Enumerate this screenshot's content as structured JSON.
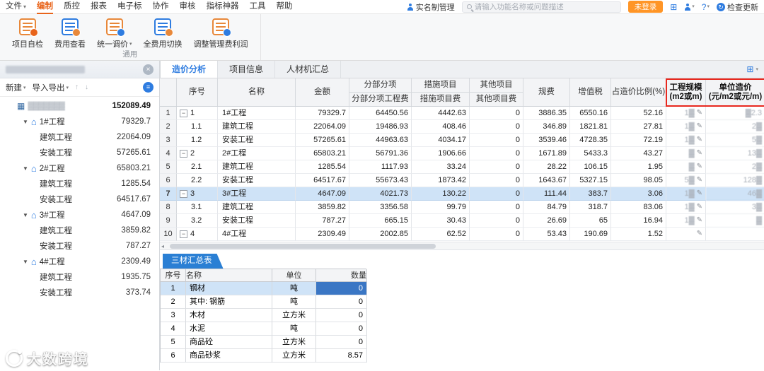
{
  "menubar": {
    "items": [
      {
        "label": "文件",
        "caret": true
      },
      {
        "label": "编制",
        "active": true
      },
      {
        "label": "质控"
      },
      {
        "label": "报表"
      },
      {
        "label": "电子标"
      },
      {
        "label": "协作"
      },
      {
        "label": "审核"
      },
      {
        "label": "指标神器"
      },
      {
        "label": "工具"
      },
      {
        "label": "帮助"
      }
    ],
    "realname_label": "实名制管理",
    "search_placeholder": "请输入功能名称或问题描述",
    "login_badge": "未登录",
    "check_update_label": "检查更新"
  },
  "ribbon": {
    "group_label": "通用",
    "buttons": [
      {
        "label": "项目自检",
        "icon": "project-check-icon"
      },
      {
        "label": "费用查看",
        "icon": "fee-view-icon"
      },
      {
        "label": "统一调价",
        "icon": "unified-price-adjust-icon",
        "caret": true
      },
      {
        "label": "全费用切换",
        "icon": "full-fee-toggle-icon"
      },
      {
        "label": "调整管理费利润",
        "icon": "adjust-manage-fee-icon"
      }
    ]
  },
  "sidebar": {
    "actions": [
      {
        "label": "新建",
        "caret": true
      },
      {
        "label": "导入导出",
        "caret": true
      }
    ],
    "tree": [
      {
        "level": 0,
        "icon": "building",
        "masked": true,
        "label": "▓▓▓▓▓▓▓",
        "value": "152089.49",
        "bold": true
      },
      {
        "level": 1,
        "icon": "house",
        "caret": true,
        "label": "1#工程",
        "value": "79329.7"
      },
      {
        "level": 2,
        "label": "建筑工程",
        "value": "22064.09"
      },
      {
        "level": 2,
        "label": "安装工程",
        "value": "57265.61"
      },
      {
        "level": 1,
        "icon": "house",
        "caret": true,
        "label": "2#工程",
        "value": "65803.21"
      },
      {
        "level": 2,
        "label": "建筑工程",
        "value": "1285.54"
      },
      {
        "level": 2,
        "label": "安装工程",
        "value": "64517.67"
      },
      {
        "level": 1,
        "icon": "house",
        "caret": true,
        "label": "3#工程",
        "value": "4647.09"
      },
      {
        "level": 2,
        "label": "建筑工程",
        "value": "3859.82"
      },
      {
        "level": 2,
        "label": "安装工程",
        "value": "787.27"
      },
      {
        "level": 1,
        "icon": "house",
        "caret": true,
        "label": "4#工程",
        "value": "2309.49"
      },
      {
        "level": 2,
        "label": "建筑工程",
        "value": "1935.75"
      },
      {
        "level": 2,
        "label": "安装工程",
        "value": "373.74"
      }
    ]
  },
  "tabs": [
    {
      "label": "造价分析",
      "active": true
    },
    {
      "label": "项目信息"
    },
    {
      "label": "人材机汇总"
    }
  ],
  "grid": {
    "header": {
      "xuhao": "序号",
      "mingcheng": "名称",
      "jine": "金额",
      "fbfx": "分部分项",
      "fbfx_sub": "分部分项工程费",
      "csxm": "措施项目",
      "csxm_sub": "措施项目费",
      "qtxm": "其他项目",
      "qtxm_sub": "其他项目费",
      "guifei": "规费",
      "zengzhishui": "增值税",
      "zhanbi": "占造价比例(%)",
      "gcgm": "工程规模",
      "gcgm_sub": "(m2或m)",
      "dwzj": "单位造价",
      "dwzj_sub": "(元/m2或元/m)"
    },
    "rows": [
      {
        "idx": "1",
        "expand": true,
        "seq": "1",
        "name": "1#工程",
        "amount": "79329.7",
        "fbfx": "64450.56",
        "csxm": "4442.63",
        "qtxm": "0",
        "gf": "3886.35",
        "zzs": "6550.16",
        "ratio": "52.16",
        "scale": "1▓",
        "unit": "▓2.3"
      },
      {
        "idx": "2",
        "seq": "1.1",
        "name": "建筑工程",
        "amount": "22064.09",
        "fbfx": "19486.93",
        "csxm": "408.46",
        "qtxm": "0",
        "gf": "346.89",
        "zzs": "1821.81",
        "ratio": "27.81",
        "scale": "1▓",
        "unit": "2▓"
      },
      {
        "idx": "3",
        "seq": "1.2",
        "name": "安装工程",
        "amount": "57265.61",
        "fbfx": "44963.63",
        "csxm": "4034.17",
        "qtxm": "0",
        "gf": "3539.46",
        "zzs": "4728.35",
        "ratio": "72.19",
        "scale": "1▓",
        "unit": "5▓"
      },
      {
        "idx": "4",
        "expand": true,
        "seq": "2",
        "name": "2#工程",
        "amount": "65803.21",
        "fbfx": "56791.36",
        "csxm": "1906.66",
        "qtxm": "0",
        "gf": "1671.89",
        "zzs": "5433.3",
        "ratio": "43.27",
        "scale": "▓",
        "unit": "13▓"
      },
      {
        "idx": "5",
        "seq": "2.1",
        "name": "建筑工程",
        "amount": "1285.54",
        "fbfx": "1117.93",
        "csxm": "33.24",
        "qtxm": "0",
        "gf": "28.22",
        "zzs": "106.15",
        "ratio": "1.95",
        "scale": "▓",
        "unit": "2▓"
      },
      {
        "idx": "6",
        "seq": "2.2",
        "name": "安装工程",
        "amount": "64517.67",
        "fbfx": "55673.43",
        "csxm": "1873.42",
        "qtxm": "0",
        "gf": "1643.67",
        "zzs": "5327.15",
        "ratio": "98.05",
        "scale": "5▓",
        "unit": "128▓"
      },
      {
        "idx": "7",
        "selected": true,
        "expand": true,
        "seq": "3",
        "name": "3#工程",
        "amount": "4647.09",
        "fbfx": "4021.73",
        "csxm": "130.22",
        "qtxm": "0",
        "gf": "111.44",
        "zzs": "383.7",
        "ratio": "3.06",
        "scale": "1▓",
        "unit": "46▓"
      },
      {
        "idx": "8",
        "seq": "3.1",
        "name": "建筑工程",
        "amount": "3859.82",
        "fbfx": "3356.58",
        "csxm": "99.79",
        "qtxm": "0",
        "gf": "84.79",
        "zzs": "318.7",
        "ratio": "83.06",
        "scale": "1▓",
        "unit": "3▓"
      },
      {
        "idx": "9",
        "seq": "3.2",
        "name": "安装工程",
        "amount": "787.27",
        "fbfx": "665.15",
        "csxm": "30.43",
        "qtxm": "0",
        "gf": "26.69",
        "zzs": "65",
        "ratio": "16.94",
        "scale": "1▓",
        "unit": "▓"
      },
      {
        "idx": "10",
        "expand": true,
        "seq": "4",
        "name": "4#工程",
        "amount": "2309.49",
        "fbfx": "2002.85",
        "csxm": "62.52",
        "qtxm": "0",
        "gf": "53.43",
        "zzs": "190.69",
        "ratio": "1.52",
        "scale": "",
        "unit": ""
      }
    ]
  },
  "bottom": {
    "tab_label": "三材汇总表",
    "headers": [
      "序号",
      "名称",
      "单位",
      "数量"
    ],
    "rows": [
      {
        "idx": "1",
        "name": "钢材",
        "unit": "吨",
        "qty": "0",
        "selected": true
      },
      {
        "idx": "2",
        "name": "其中: 钢筋",
        "unit": "吨",
        "qty": "0"
      },
      {
        "idx": "3",
        "name": "木材",
        "unit": "立方米",
        "qty": "0"
      },
      {
        "idx": "4",
        "name": "水泥",
        "unit": "吨",
        "qty": "0"
      },
      {
        "idx": "5",
        "name": "商品砼",
        "unit": "立方米",
        "qty": "0"
      },
      {
        "idx": "6",
        "name": "商品砂浆",
        "unit": "立方米",
        "qty": "8.57"
      }
    ]
  },
  "watermark": "大数跨境",
  "colors": {
    "accent_orange": "#e8641b",
    "accent_blue": "#2e7ce0",
    "selected_row": "#cfe3f7",
    "highlight_red": "#e8281e",
    "login_badge_bg": "#ff9526",
    "bottom_tab_bg": "#2a7fd4"
  }
}
